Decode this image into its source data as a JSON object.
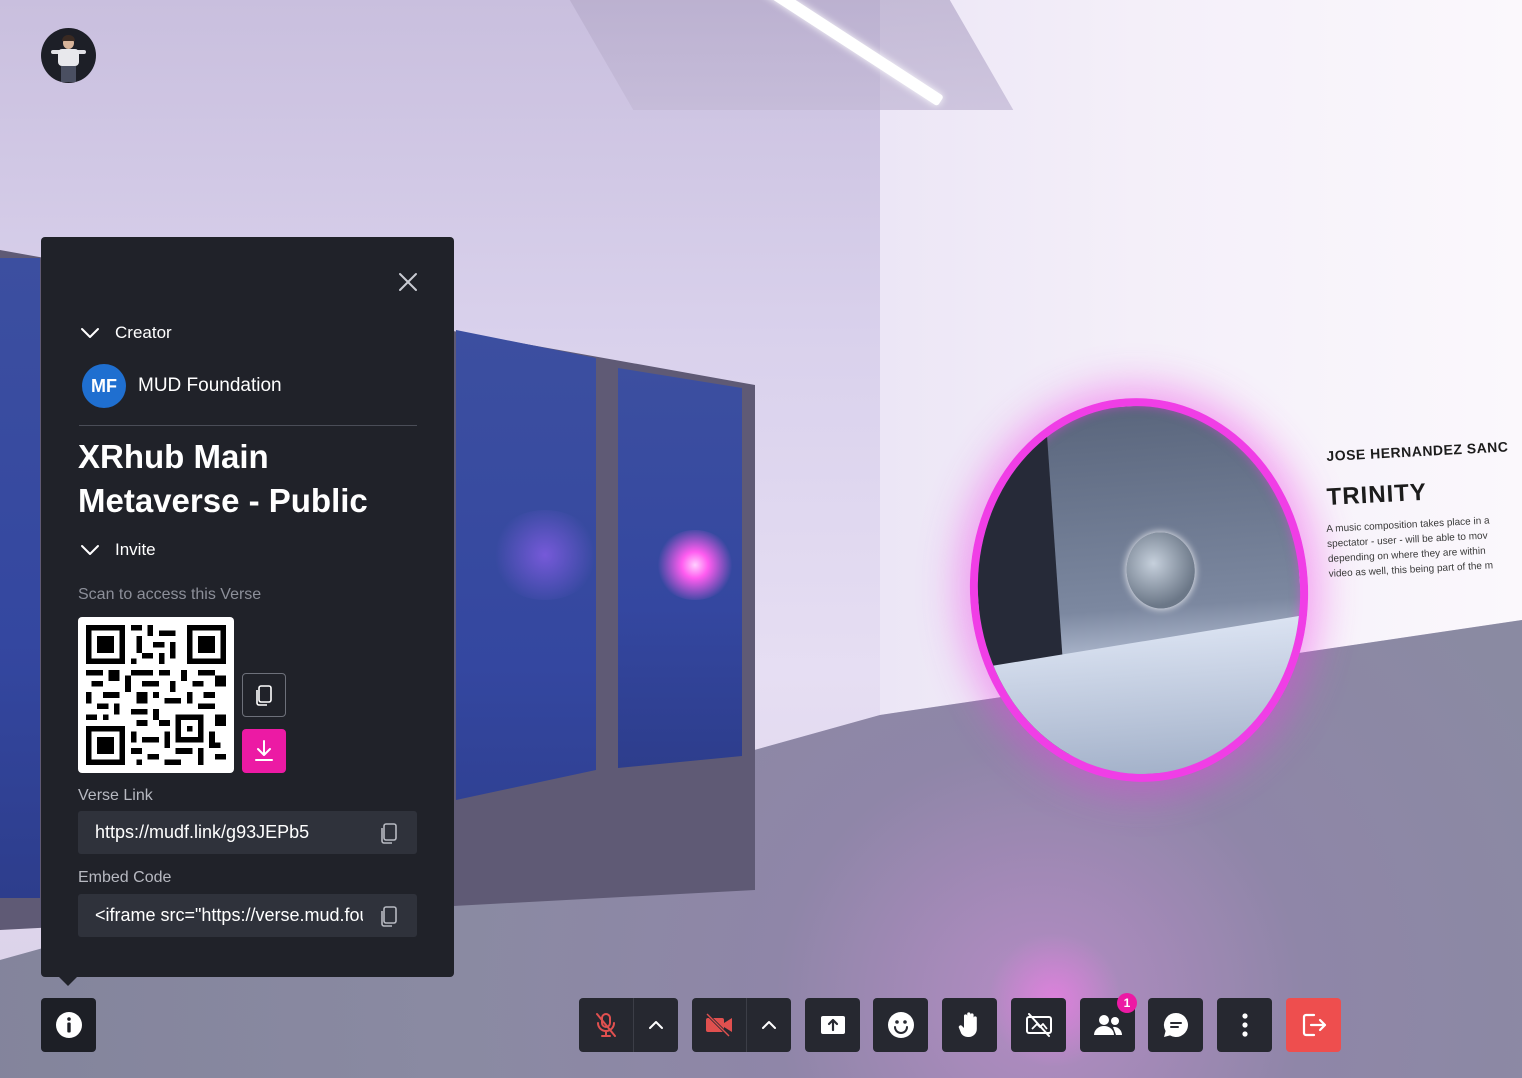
{
  "panel": {
    "creator_section_label": "Creator",
    "creator_initials": "MF",
    "creator_name": "MUD Foundation",
    "verse_title": "XRhub Main Metaverse - Public",
    "invite_section_label": "Invite",
    "scan_label": "Scan to access this Verse",
    "verse_link_label": "Verse Link",
    "verse_link_value": "https://mudf.link/g93JEPb5",
    "embed_code_label": "Embed Code",
    "embed_code_value": "<iframe src=\"https://verse.mud.foundation"
  },
  "artwork": {
    "artist": "JOSE HERNANDEZ SANC",
    "title": "TRINITY",
    "description_lines": [
      "A music composition takes place in a",
      "spectator - user - will be able to mov",
      "depending on where they are within",
      "video as well, this being part of the m"
    ]
  },
  "toolbar": {
    "participants_count": "1",
    "buttons": [
      "info-icon",
      "mic-off-icon",
      "camera-off-icon",
      "share-screen-icon",
      "emoji-icon",
      "raise-hand-icon",
      "hide-video-icon",
      "participants-icon",
      "chat-icon",
      "more-icon",
      "leave-icon"
    ]
  },
  "colors": {
    "accent_pink": "#ec1aa4",
    "leave_red": "#ee4e4e",
    "muted_red": "#e0504f",
    "panel_bg": "#202229",
    "creator_badge_blue": "#1f6fd0",
    "portal_ring": "#f03ee6"
  }
}
